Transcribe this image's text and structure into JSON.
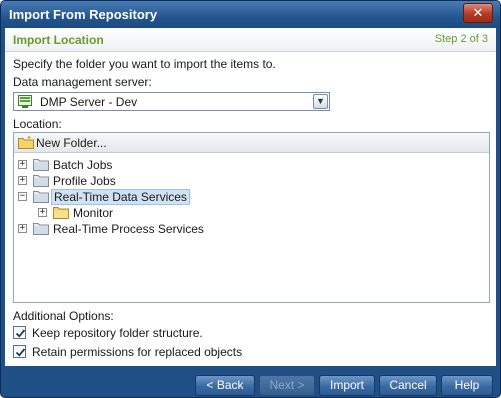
{
  "window": {
    "title": "Import From Repository",
    "close_glyph": "✕"
  },
  "header": {
    "title": "Import Location",
    "step": "Step 2 of 3"
  },
  "form": {
    "instruction": "Specify the folder you want to import the items to.",
    "server_label": "Data management server:",
    "server_value": "DMP Server - Dev",
    "server_icon": "server-icon",
    "location_label": "Location:"
  },
  "toolbar": {
    "new_folder_label": "New Folder..."
  },
  "tree": {
    "nodes": [
      {
        "label": "Batch Jobs",
        "expander": "+",
        "selected": false
      },
      {
        "label": "Profile Jobs",
        "expander": "+",
        "selected": false
      },
      {
        "label": "Real-Time Data Services",
        "expander": "−",
        "selected": true
      },
      {
        "label": "Monitor",
        "expander": "+",
        "selected": false
      },
      {
        "label": "Real-Time Process Services",
        "expander": "+",
        "selected": false
      }
    ]
  },
  "options": {
    "label": "Additional Options:",
    "keep_structure": {
      "label": "Keep repository folder structure.",
      "checked": true
    },
    "retain_permissions": {
      "label": "Retain permissions for replaced objects",
      "checked": true
    }
  },
  "buttons": {
    "back": "< Back",
    "next": "Next >",
    "import": "Import",
    "cancel": "Cancel",
    "help": "Help"
  },
  "colors": {
    "frame": "#1f4f84",
    "header_accent": "#6a9a2a",
    "selection": "#cfe2f5"
  }
}
